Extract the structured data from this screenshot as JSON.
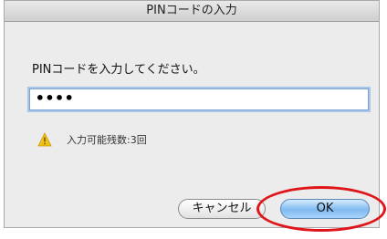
{
  "dialog": {
    "title": "PINコードの入力",
    "prompt": "PINコードを入力してください。",
    "pin_value": "••••",
    "remaining_attempts": "入力可能残数:3回",
    "warning_icon": "warning-triangle-icon",
    "cancel_label": "キャンセル",
    "ok_label": "OK"
  },
  "colors": {
    "accent_button": "#7fbaf0",
    "annotation": "#e0151a",
    "warning": "#f2c21b"
  }
}
